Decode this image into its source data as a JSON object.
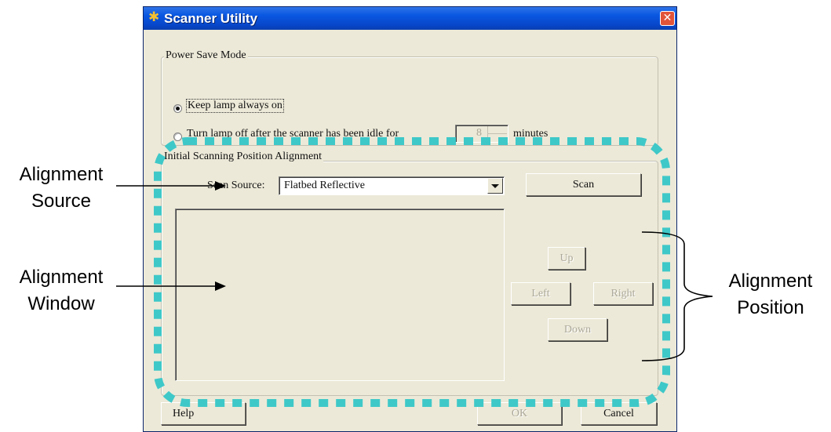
{
  "window": {
    "title": "Scanner Utility"
  },
  "power_save": {
    "legend": "Power Save Mode",
    "option_always_on": "Keep lamp always on",
    "option_idle_off": "Turn lamp off after the scanner has been idle for",
    "idle_minutes": "8",
    "minutes_label": "minutes",
    "selected": "always_on"
  },
  "alignment": {
    "legend": "Initial Scanning Position Alignment",
    "source_label": "Scan Source:",
    "source_value": "Flatbed Reflective",
    "scan_button": "Scan",
    "up_button": "Up",
    "left_button": "Left",
    "right_button": "Right",
    "down_button": "Down"
  },
  "footer": {
    "help_button": "Help",
    "ok_button": "OK",
    "cancel_button": "Cancel"
  },
  "annotations": {
    "source_line1": "Alignment",
    "source_line2": "Source",
    "window_line1": "Alignment",
    "window_line2": "Window",
    "position_line1": "Alignment",
    "position_line2": "Position"
  },
  "colors": {
    "highlight_dash": "#3fc8c8",
    "dialog_bg": "#ece9d8",
    "titlebar": "#0a58e2"
  }
}
